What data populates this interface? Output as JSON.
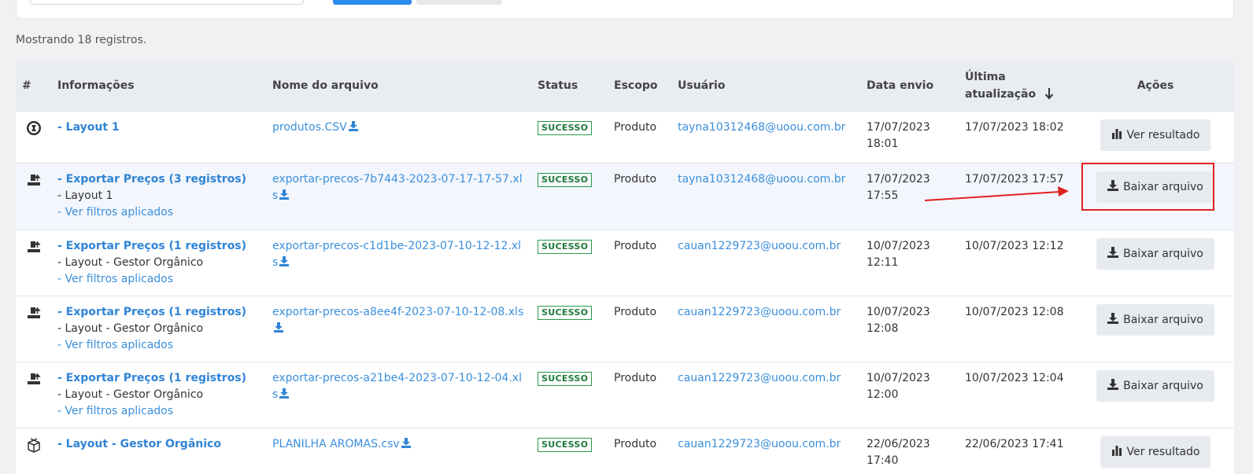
{
  "summary": {
    "count_text": "Mostrando 18 registros."
  },
  "table": {
    "headers": {
      "num": "#",
      "info": "Informações",
      "file": "Nome do arquivo",
      "status": "Status",
      "scope": "Escopo",
      "user": "Usuário",
      "sent": "Data envio",
      "updated_line1": "Última",
      "updated_line2": "atualização",
      "actions": "Ações"
    },
    "rows": [
      {
        "icon": "globe-icon",
        "title": "- Layout 1",
        "sub": "",
        "filters": "",
        "file": "produtos.CSV",
        "status": "SUCESSO",
        "scope": "Produto",
        "user": "tayna10312468@uoou.com.br",
        "sent": "17/07/2023 18:01",
        "updated": "17/07/2023 18:02",
        "action": "Ver resultado",
        "action_icon": "bar-chart-icon"
      },
      {
        "icon": "export-icon",
        "title": "- Exportar Preços (3 registros)",
        "sub": "- Layout 1",
        "filters": "- Ver filtros aplicados",
        "file": "exportar-precos-7b7443-2023-07-17-17-57.xls",
        "status": "SUCESSO",
        "scope": "Produto",
        "user": "tayna10312468@uoou.com.br",
        "sent": "17/07/2023 17:55",
        "updated": "17/07/2023 17:57",
        "action": "Baixar arquivo",
        "action_icon": "download-icon"
      },
      {
        "icon": "export-icon",
        "title": "- Exportar Preços (1 registros)",
        "sub": "- Layout - Gestor Orgânico",
        "filters": "- Ver filtros aplicados",
        "file": "exportar-precos-c1d1be-2023-07-10-12-12.xls",
        "status": "SUCESSO",
        "scope": "Produto",
        "user": "cauan1229723@uoou.com.br",
        "sent": "10/07/2023 12:11",
        "updated": "10/07/2023 12:12",
        "action": "Baixar arquivo",
        "action_icon": "download-icon"
      },
      {
        "icon": "export-icon",
        "title": "- Exportar Preços (1 registros)",
        "sub": "- Layout - Gestor Orgânico",
        "filters": "- Ver filtros aplicados",
        "file": "exportar-precos-a8ee4f-2023-07-10-12-08.xls",
        "status": "SUCESSO",
        "scope": "Produto",
        "user": "cauan1229723@uoou.com.br",
        "sent": "10/07/2023 12:08",
        "updated": "10/07/2023 12:08",
        "action": "Baixar arquivo",
        "action_icon": "download-icon"
      },
      {
        "icon": "export-icon",
        "title": "- Exportar Preços (1 registros)",
        "sub": "- Layout - Gestor Orgânico",
        "filters": "- Ver filtros aplicados",
        "file": "exportar-precos-a21be4-2023-07-10-12-04.xls",
        "status": "SUCESSO",
        "scope": "Produto",
        "user": "cauan1229723@uoou.com.br",
        "sent": "10/07/2023 12:00",
        "updated": "10/07/2023 12:04",
        "action": "Baixar arquivo",
        "action_icon": "download-icon"
      },
      {
        "icon": "box-icon",
        "title": "- Layout - Gestor Orgânico",
        "sub": "",
        "filters": "",
        "file": "PLANILHA AROMAS.csv",
        "status": "SUCESSO",
        "scope": "Produto",
        "user": "cauan1229723@uoou.com.br",
        "sent": "22/06/2023 17:40",
        "updated": "22/06/2023 17:41",
        "action": "Ver resultado",
        "action_icon": "bar-chart-icon"
      }
    ]
  },
  "colors": {
    "link": "#3a8fdc",
    "success": "#2a9a4a",
    "header_bg": "#e9ecf1",
    "highlight": "#e02020"
  }
}
